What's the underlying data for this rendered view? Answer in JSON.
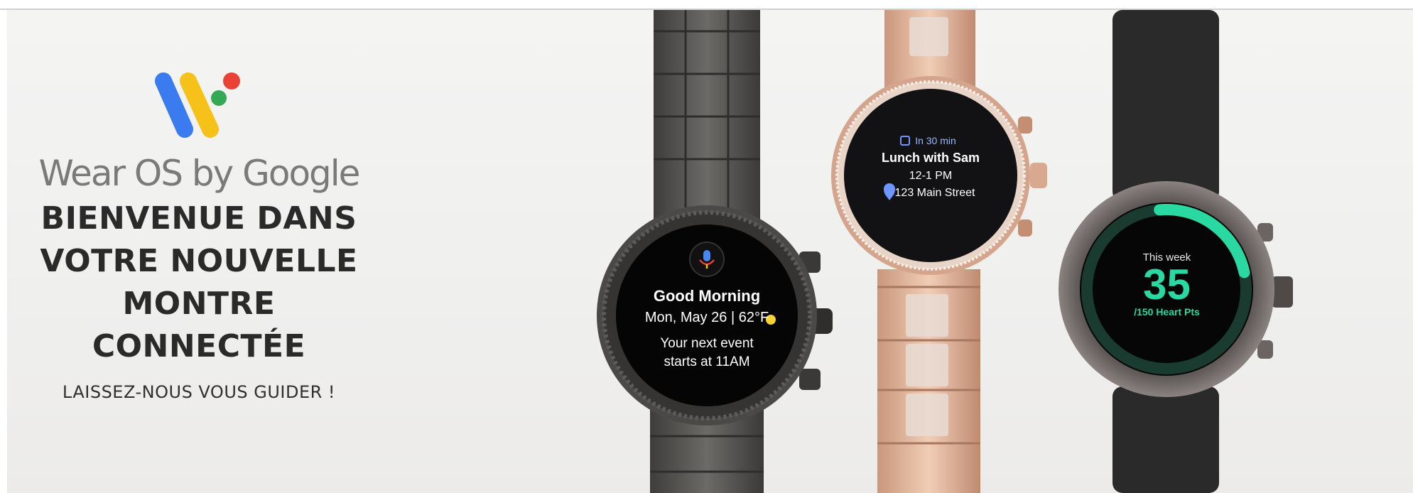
{
  "hero": {
    "brand": "Wear OS by Google",
    "headline_lines": [
      "BIENVENUE DANS",
      "VOTRE NOUVELLE",
      "MONTRE",
      "CONNECTÉE"
    ],
    "subline": "LAISSEZ-NOUS VOUS GUIDER !"
  },
  "colors": {
    "logo_blue": "#3b7bf0",
    "logo_yellow": "#f6c21a",
    "logo_red": "#ea4335",
    "logo_green": "#34a853",
    "fitness_green": "#2ad8a2"
  },
  "watch1": {
    "title": "Good Morning",
    "date": "Mon, May 26 | 62°F",
    "event_line1": "Your next event",
    "event_line2": "starts at 11AM",
    "icon": "microphone-icon"
  },
  "watch2": {
    "line1": "In 30 min",
    "title": "Lunch with Sam",
    "time": "12-1 PM",
    "address": "123 Main Street",
    "icons": [
      "calendar-icon",
      "location-pin-icon"
    ]
  },
  "watch3": {
    "label": "This week",
    "value": "35",
    "suffix": "/150 Heart Pts",
    "progress_fraction": 0.23
  }
}
